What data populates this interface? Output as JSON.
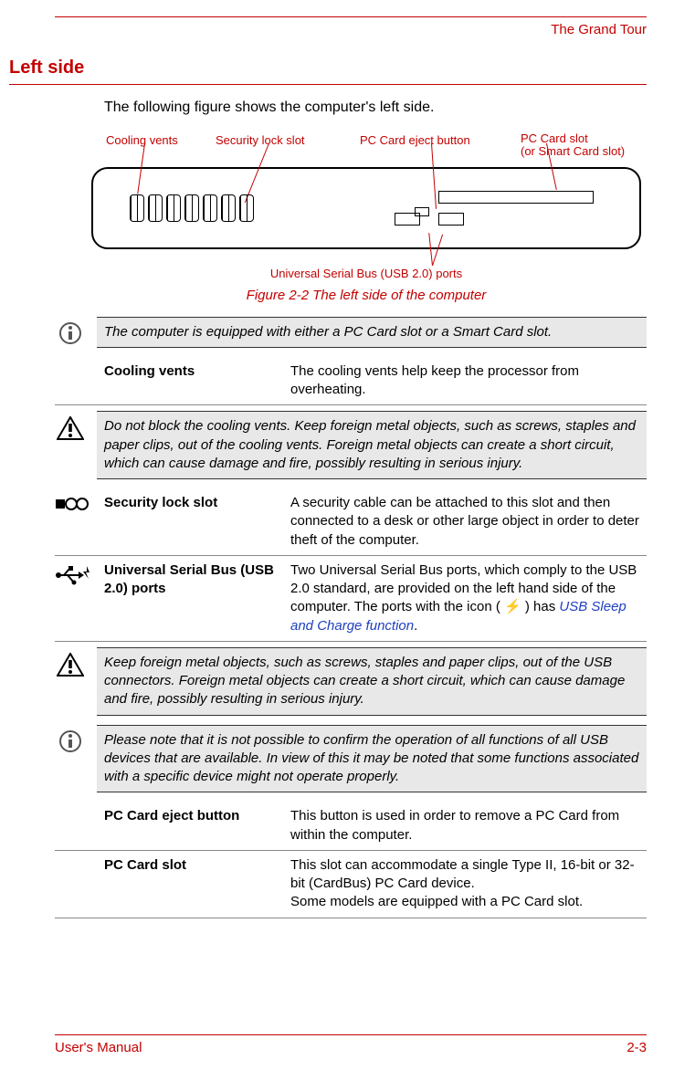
{
  "header": {
    "chapter": "The Grand Tour"
  },
  "section": {
    "heading": "Left side",
    "intro": "The following figure shows the computer's left side."
  },
  "figure": {
    "labels": {
      "cooling": "Cooling vents",
      "lockslot": "Security lock slot",
      "eject": "PC Card eject button",
      "pccard1": "PC Card slot",
      "pccard2": " (or Smart Card slot)",
      "usb": "Universal Serial Bus (USB 2.0) ports"
    },
    "caption": "Figure 2-2 The left side of the computer"
  },
  "notes": {
    "n1": "The computer is equipped with either a PC Card slot or a Smart Card slot.",
    "n2": "Do not block the cooling vents. Keep foreign metal objects, such as screws, staples and paper clips, out of the cooling vents. Foreign metal objects can create a short circuit, which can cause damage and fire, possibly resulting in serious injury.",
    "n3": "Keep foreign metal objects, such as screws, staples and paper clips, out of the USB connectors. Foreign metal objects can create a short circuit, which can cause damage and fire, possibly resulting in serious injury.",
    "n4": "Please note that it is not possible to confirm the operation of all functions of all USB devices that are available. In view of this it may be noted that some functions associated with a specific device might not operate properly."
  },
  "defs": {
    "d1": {
      "term": "Cooling vents",
      "desc": "The cooling vents help keep the processor from overheating."
    },
    "d2": {
      "term": "Security lock slot",
      "desc": "A security cable can be attached to this slot and then connected to a desk or other large object in order to deter theft of the computer."
    },
    "d3": {
      "term": "Universal Serial Bus (USB 2.0) ports",
      "desc_a": "Two Universal Serial Bus ports, which comply to the USB 2.0 standard, are provided on the left hand side of the computer. The ports with the icon (",
      "desc_b": ") has ",
      "link": "USB Sleep and Charge function",
      "desc_c": "."
    },
    "d4": {
      "term": "PC Card eject button",
      "desc": "This button is used in order to remove a PC Card from within the computer."
    },
    "d5": {
      "term": "PC Card slot",
      "desc_a": "This slot can accommodate a single Type II, 16-bit or 32-bit (CardBus) PC Card device.",
      "desc_b": "Some models are equipped with a PC Card slot."
    }
  },
  "footer": {
    "left": "User's Manual",
    "right": "2-3"
  }
}
